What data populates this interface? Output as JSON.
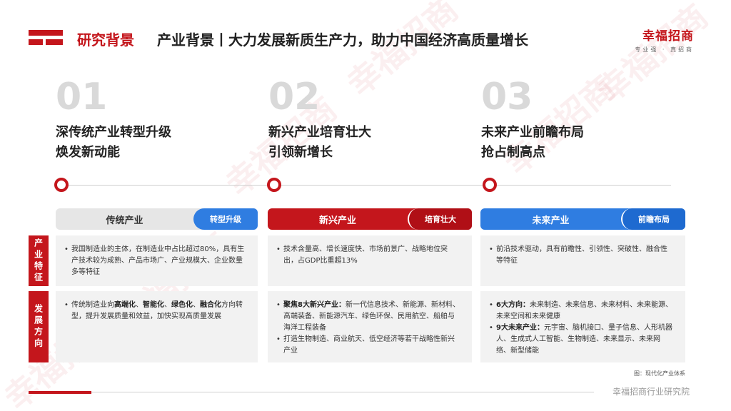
{
  "header": {
    "section_tag": "研究背景",
    "title": "产业背景丨大力发展新质生产力，助力中国经济高质量增长"
  },
  "brand": {
    "name": "幸福招商",
    "sub": "专业强 · 真招商",
    "color": "#c4161c"
  },
  "columns": [
    {
      "number": "01",
      "line1": "深传统产业转型升级",
      "line2": "焕发新动能"
    },
    {
      "number": "02",
      "line1": "新兴产业培育壮大",
      "line2": "引领新增长"
    },
    {
      "number": "03",
      "line1": "未来产业前瞻布局",
      "line2": "抢占制高点"
    }
  ],
  "pills": [
    {
      "label": "传统产业",
      "tag": "转型升级"
    },
    {
      "label": "新兴产业",
      "tag": "培育壮大"
    },
    {
      "label": "未来产业",
      "tag": "前瞻布局"
    }
  ],
  "row_labels": [
    "产业特征",
    "发展方向"
  ],
  "features": [
    "我国制造业的主体，在制造业中占比超过80%，具有生产技术较为成熟、产品市场广、产业规模大、企业数量多等特征",
    "技术含量高、增长速度快、市场前景广、战略地位突出，占GDP比重超13%",
    "前沿技术驱动，具有前瞻性、引领性、突破性、融合性等特征"
  ],
  "directions": {
    "traditional": {
      "prefix": "传统制造业向",
      "b1": "高端化",
      "s1": "、",
      "b2": "智能化",
      "s2": "、",
      "b3": "绿色化",
      "s3": "、",
      "b4": "融合化",
      "suffix": "方向转型，提升发展质量和效益，加快实现高质量发展"
    },
    "emerging": [
      {
        "bold": "聚焦8大新兴产业：",
        "text": "新一代信息技术、新能源、新材料、高端装备、新能源汽车、绿色环保、民用航空、船舶与海洋工程装备"
      },
      {
        "bold": "",
        "text": "打造生物制造、商业航天、低空经济等若干战略性新兴产业"
      }
    ],
    "future": [
      {
        "bold": "6大方向：",
        "text": "未来制造、未来信息、未来材料、未来能源、未来空间和未来健康"
      },
      {
        "bold": "9大未来产业：",
        "text": "元宇宙、脑机接口、量子信息、人形机器人、生成式人工智能、生物制造、未来显示、未来网络、新型储能"
      }
    ]
  },
  "caption": "图：现代化产业体系",
  "footer": "幸福招商行业研究院",
  "colors": {
    "accent_red": "#c4161c",
    "grey_pill": "#e6e6e6",
    "blue_pill": "#2f7de1",
    "cell_bg": "#f2f2f2"
  }
}
